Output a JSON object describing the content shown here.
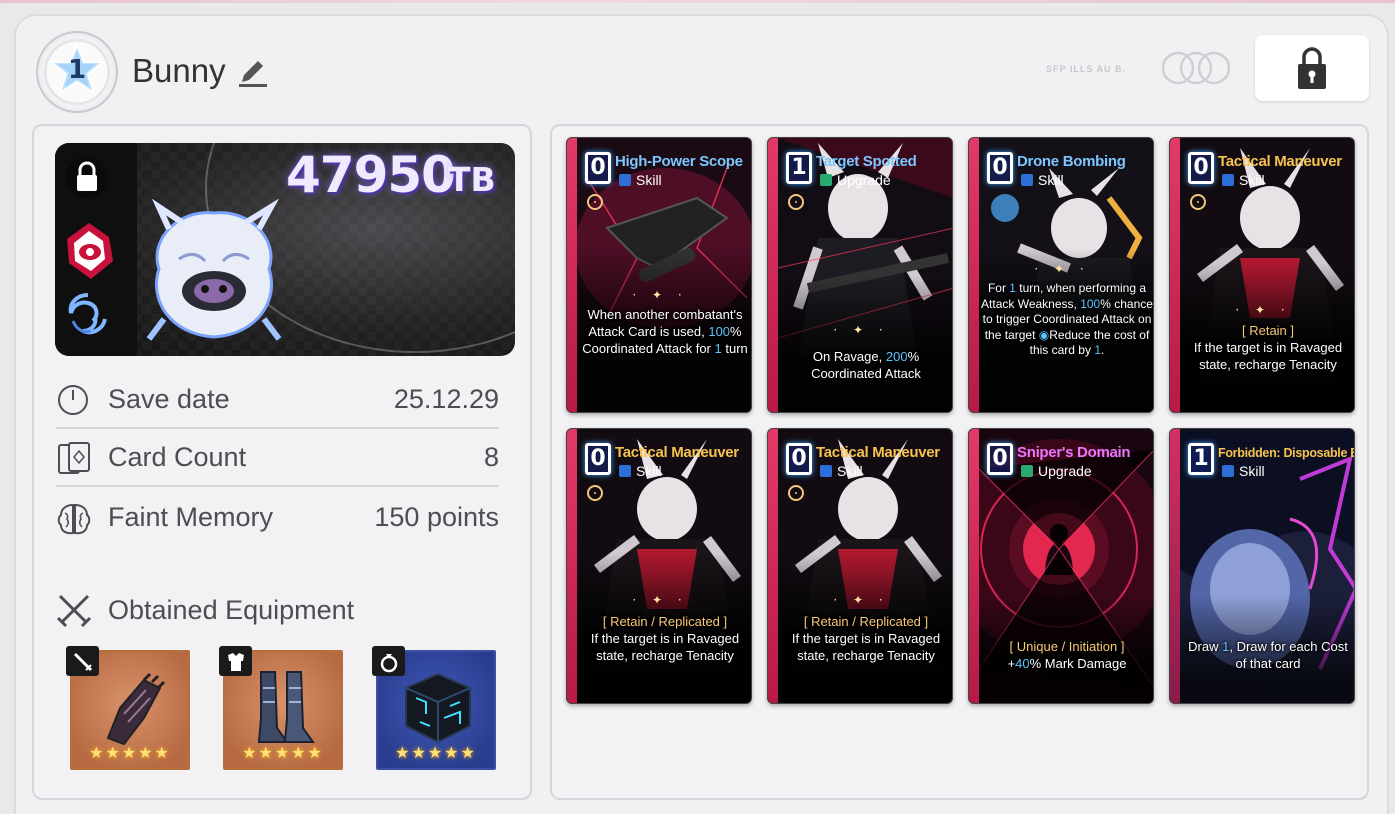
{
  "profile": {
    "rank": "1",
    "name": "Bunny",
    "faint_text": "SFP ILLS AU B."
  },
  "banner": {
    "score": "47950",
    "score_unit": "TB"
  },
  "stats": [
    {
      "label": "Save date",
      "value": "25.12.29"
    },
    {
      "label": "Card Count",
      "value": "8"
    },
    {
      "label": "Faint Memory",
      "value": "150 points"
    }
  ],
  "equipment": {
    "title": "Obtained Equipment",
    "items": [
      {
        "slot": "weapon",
        "stars": "★★★★★",
        "rarity": "orange"
      },
      {
        "slot": "armor",
        "stars": "★★★★★",
        "rarity": "orange"
      },
      {
        "slot": "accessory",
        "stars": "★★★★★",
        "rarity": "blue"
      }
    ]
  },
  "cards": [
    {
      "cost": "0",
      "name": "High-Power Scope",
      "type": "Skill",
      "name_color": "#7ec6ff",
      "desc_pre": "When another combatant's Attack Card is used, ",
      "desc_hl": "100",
      "desc_post": "% Coordinated Attack for ",
      "desc_hl2": "1",
      "desc_post2": " turn"
    },
    {
      "cost": "1",
      "name": "Target Spotted",
      "type": "Upgrade",
      "name_color": "#7ec6ff",
      "desc_pre": "On Ravage, ",
      "desc_hl": "200",
      "desc_post": "% Coordinated Attack",
      "desc_hl2": "",
      "desc_post2": ""
    },
    {
      "cost": "0",
      "name": "Drone Bombing",
      "type": "Skill",
      "name_color": "#7ec6ff",
      "desc_pre": "For ",
      "desc_hl": "1",
      "desc_post": " turn, when performing a Attack Weakness, ",
      "desc_hl2": "100",
      "desc_post2": "% chance to trigger Coordinated Attack on the target ",
      "desc_extra": "Reduce the cost of this card by ",
      "desc_hl3": "1",
      "desc_post3": "."
    },
    {
      "cost": "0",
      "name": "Tactical Maneuver",
      "type": "Skill",
      "name_color": "#f7c34f",
      "keyword": "[ Retain ]",
      "desc_pre": "If the target is in Ravaged state, recharge Tenacity"
    },
    {
      "cost": "0",
      "name": "Tactical Maneuver",
      "type": "Skill",
      "name_color": "#f7c34f",
      "keyword": "[ Retain / Replicated ]",
      "desc_pre": "If the target is in Ravaged state, recharge Tenacity"
    },
    {
      "cost": "0",
      "name": "Tactical Maneuver",
      "type": "Skill",
      "name_color": "#f7c34f",
      "keyword": "[ Retain / Replicated ]",
      "desc_pre": "If the target is in Ravaged state, recharge Tenacity"
    },
    {
      "cost": "0",
      "name": "Sniper's Domain",
      "type": "Upgrade",
      "name_color": "#ee74ff",
      "keyword": "[ Unique / Initiation ]",
      "desc_pre": "+",
      "desc_hl": "40",
      "desc_post": "% Mark Damage"
    },
    {
      "cost": "1",
      "name": "Forbidden: Disposable Ego",
      "type": "Skill",
      "name_color": "#f7c34f",
      "desc_pre": "Draw ",
      "desc_hl": "1",
      "desc_post": ", Draw for each Cost of that card"
    }
  ],
  "colors": {
    "card_edge": "#d92356",
    "score_glow": "#6a4ac9",
    "equip_orange": "#c07a50",
    "equip_blue": "#2f4498"
  }
}
